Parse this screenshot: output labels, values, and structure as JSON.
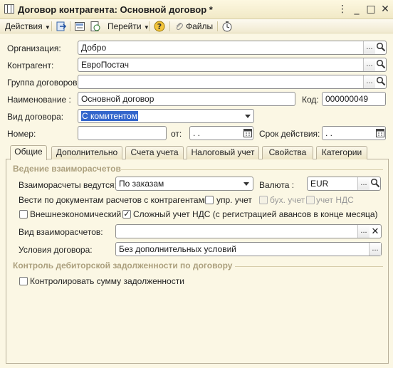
{
  "window": {
    "title": "Договор контрагента: Основной договор *",
    "controls": {
      "minimize": "_",
      "maximize": "□",
      "close": "✕"
    }
  },
  "toolbar": {
    "actions_label": "Действия",
    "goto_label": "Перейти",
    "files_label": "Файлы"
  },
  "form": {
    "organization": {
      "label": "Организация:",
      "value": "Добро"
    },
    "counterparty": {
      "label": "Контрагент:",
      "value": "ЕвроПостач"
    },
    "contract_group": {
      "label": "Группа договоров:",
      "value": ""
    },
    "name": {
      "label": "Наименование :",
      "value": "Основной договор"
    },
    "code": {
      "label": "Код:",
      "value": "000000049"
    },
    "contract_type": {
      "label": "Вид договора:",
      "value": "С комитентом"
    },
    "number": {
      "label": "Номер:",
      "value": ""
    },
    "date_from": {
      "label": "от:",
      "value": " .  ."
    },
    "validity": {
      "label": "Срок действия:",
      "value": " .  ."
    }
  },
  "tabs": [
    {
      "label": "Общие",
      "active": true
    },
    {
      "label": "Дополнительно",
      "active": false
    },
    {
      "label": "Счета учета",
      "active": false
    },
    {
      "label": "Налоговый учет",
      "active": false
    },
    {
      "label": "Свойства",
      "active": false
    },
    {
      "label": "Категории",
      "active": false
    }
  ],
  "general": {
    "section_settlements": "Ведение взаиморасчетов",
    "settlements_by": {
      "label": "Взаиморасчеты ведутся:",
      "value": "По заказам"
    },
    "currency": {
      "label": "Валюта :",
      "value": "EUR"
    },
    "docs_label": "Вести по документам расчетов с контрагентами:",
    "mgmt_acc": {
      "label": "упр. учет",
      "checked": false
    },
    "book_acc": {
      "label": "бух. учет",
      "checked": false,
      "disabled": true
    },
    "vat_acc": {
      "label": "учет НДС",
      "checked": false,
      "disabled": true
    },
    "foreign_trade": {
      "label": "Внешнеэкономический",
      "checked": false
    },
    "complex_vat": {
      "label": "Сложный  учет НДС (с регистрацией авансов в конце месяца)",
      "checked": true
    },
    "settlement_type": {
      "label": "Вид взаиморасчетов:",
      "value": ""
    },
    "terms": {
      "label": "Условия договора:",
      "value": "Без дополнительных условий"
    },
    "section_debt": "Контроль дебиторской задолженности по договору",
    "control_debt": {
      "label": "Контролировать сумму задолженности",
      "checked": false
    }
  },
  "colors": {
    "background": "#fbf7e4",
    "section_title": "#aca07e",
    "selection": "#3366cc"
  }
}
